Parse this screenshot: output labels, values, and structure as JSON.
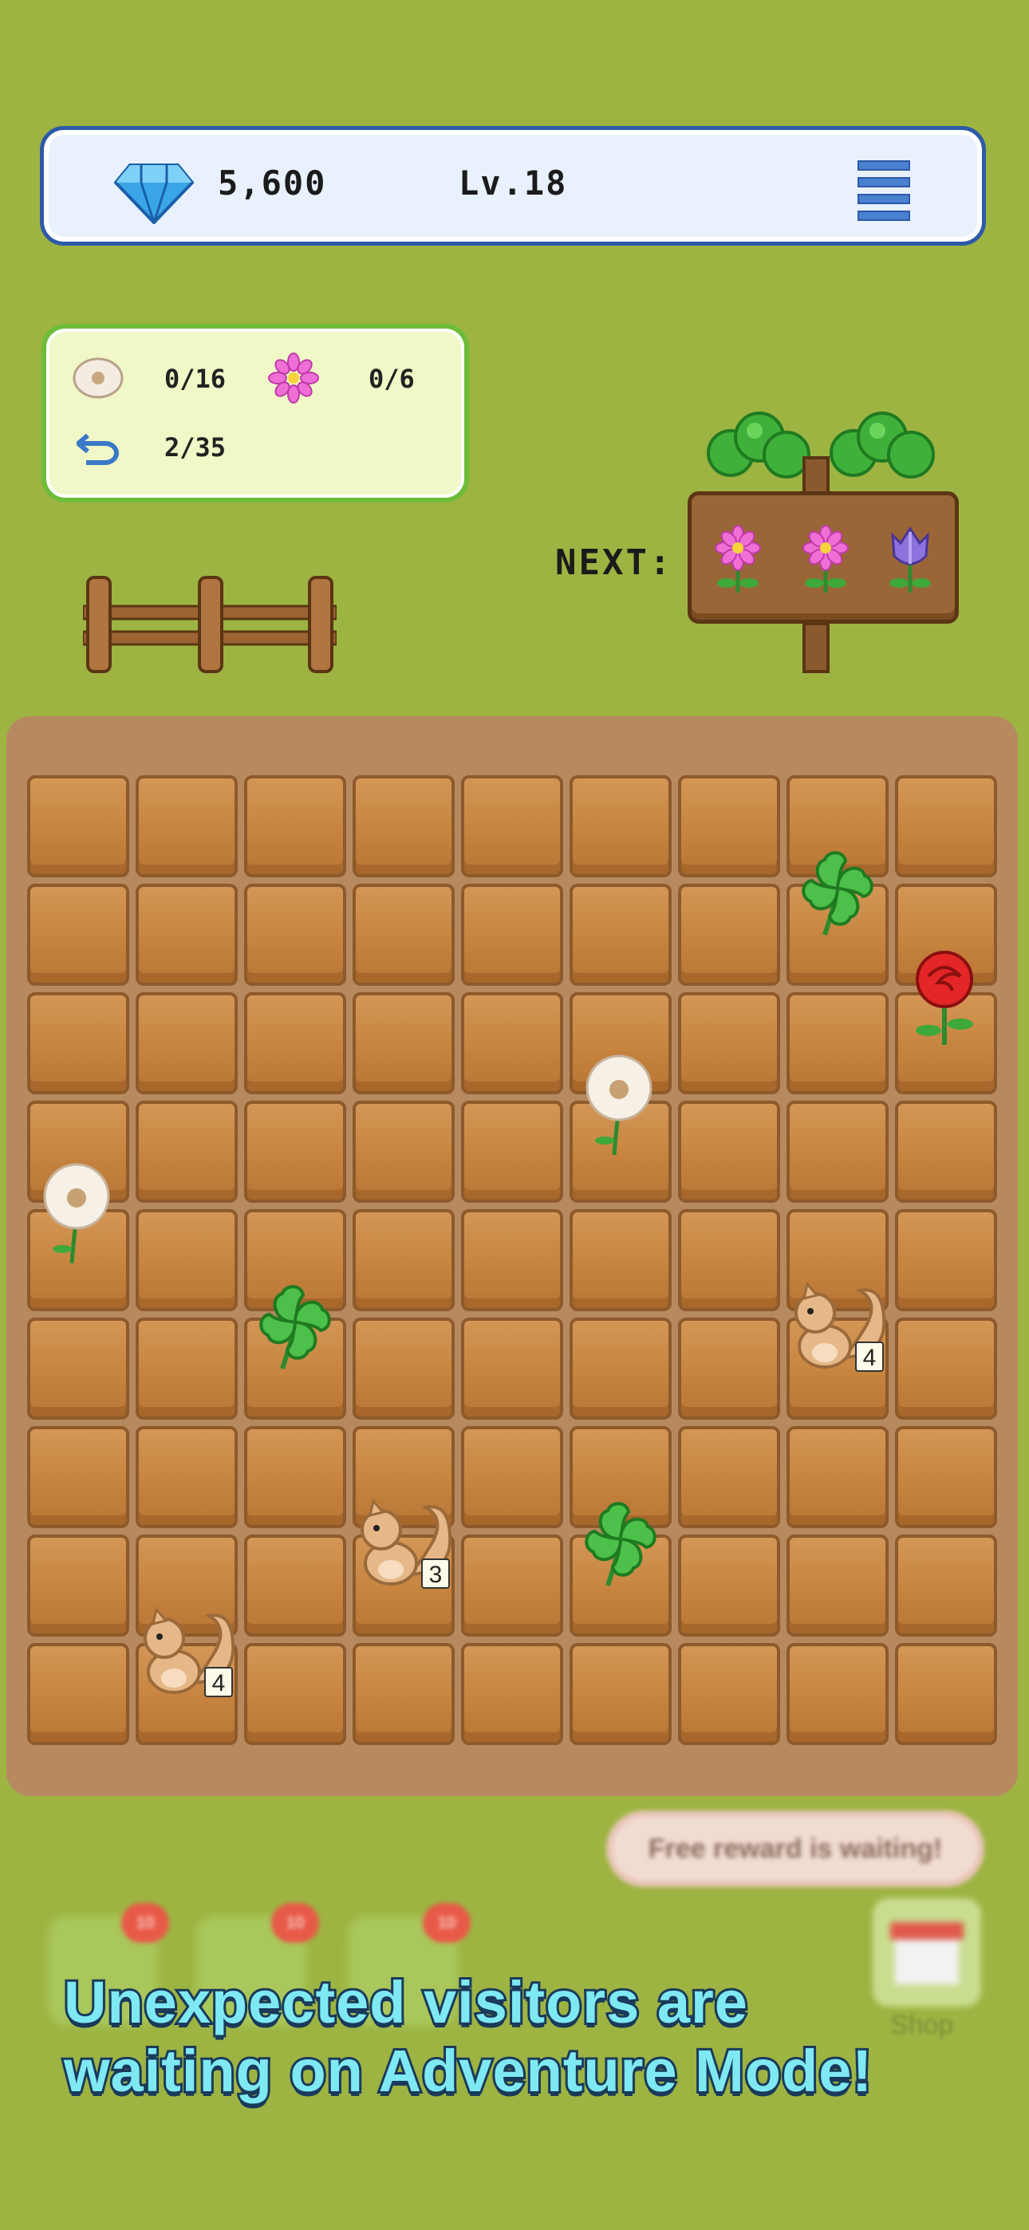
{
  "header": {
    "gems": "5,600",
    "level": "Lv.18",
    "gem_icon": "diamond-icon",
    "menu_icon": "hamburger-menu-icon"
  },
  "goals": {
    "dandelion_progress": "0/16",
    "flower_progress": "0/6",
    "moves_progress": "2/35"
  },
  "next": {
    "label": "NEXT:",
    "items": [
      "pink-flower",
      "pink-flower",
      "purple-tulip"
    ]
  },
  "board": {
    "cols": 9,
    "rows": 9,
    "pieces": [
      {
        "col": 7,
        "row": 1,
        "type": "clover"
      },
      {
        "col": 8,
        "row": 2,
        "type": "rose"
      },
      {
        "col": 5,
        "row": 3,
        "type": "dandelion"
      },
      {
        "col": 0,
        "row": 4,
        "type": "dandelion"
      },
      {
        "col": 2,
        "row": 5,
        "type": "clover"
      },
      {
        "col": 7,
        "row": 5,
        "type": "squirrel",
        "count": "4"
      },
      {
        "col": 3,
        "row": 7,
        "type": "squirrel",
        "count": "3"
      },
      {
        "col": 5,
        "row": 7,
        "type": "clover"
      },
      {
        "col": 1,
        "row": 8,
        "type": "squirrel",
        "count": "4"
      }
    ]
  },
  "bottom": {
    "reward_text": "Free reward is waiting!",
    "shop_label": "Shop",
    "badges": [
      "10",
      "10",
      "10"
    ]
  },
  "promo": {
    "line1": "Unexpected visitors are",
    "line2": "waiting on Adventure Mode!"
  },
  "colors": {
    "background": "#9db442",
    "accent": "#2d5aa8",
    "promo_text": "#7ee9f3"
  }
}
